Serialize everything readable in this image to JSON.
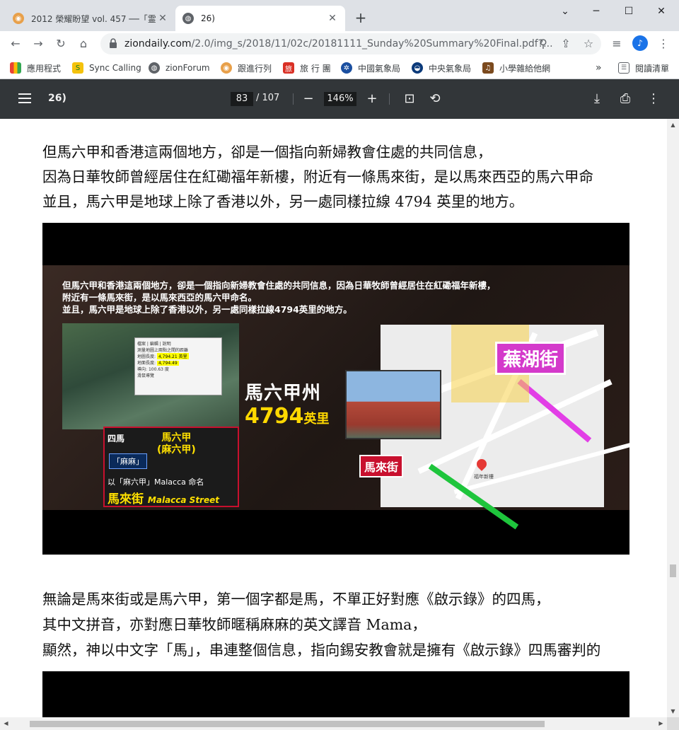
{
  "tabs": [
    {
      "title": "2012 榮耀盼望 vol. 457 ──「霊…",
      "active": false
    },
    {
      "title": "26)",
      "active": true
    }
  ],
  "window_controls": {
    "minimize": "─",
    "maximize": "☐",
    "close": "✕"
  },
  "address": {
    "domain": "ziondaily.com",
    "path": "/2.0/img_s/2018/11/02c/20181111_Sunday%20Summary%20Final.pdf?..."
  },
  "avatar_letter": "♪",
  "bookmarks": [
    {
      "label": "應用程式",
      "icon": "apps-grid-icon"
    },
    {
      "label": "Sync Calling",
      "icon": "sync-calling-icon"
    },
    {
      "label": "zionForum",
      "icon": "globe-icon"
    },
    {
      "label": "跟進行列",
      "icon": "follow-queue-icon"
    },
    {
      "label": "旅 行 團",
      "icon": "travel-icon"
    },
    {
      "label": "中國氣象局",
      "icon": "cma-icon"
    },
    {
      "label": "中央氣象局",
      "icon": "cwb-icon"
    },
    {
      "label": "小學雜給他網",
      "icon": "school-icon"
    }
  ],
  "bookmarks_more": "»",
  "reading_list": "閱讀清單",
  "pdf": {
    "doc_title": "26)",
    "current_page": "83",
    "total_pages": "/ 107",
    "zoom": "146%"
  },
  "paragraphs_top": [
    "但馬六甲和香港這兩個地方，卻是一個指向新婦教會住處的共同信息，",
    "因為日華牧師曾經居住在紅磡福年新樓，附近有一條馬來街，是以馬來西亞的馬六甲命",
    "並且，馬六甲是地球上除了香港以外，另一處同樣拉線 4794 英里的地方。"
  ],
  "slide": {
    "caption": [
      "但馬六甲和香港這兩個地方，卻是一個指向新婦教會住處的共同信息，因為日華牧師曾經居住在紅磡福年新樓，",
      "附近有一條馬來街，是以馬來西亞的馬六甲命名。",
      "並且，馬六甲是地球上除了香港以外，另一處同樣拉線4794英里的地方。"
    ],
    "dialog_lines": [
      "檔案 | 編輯 | 說明",
      "測量地圖上兩點之間的距離",
      "地圖長度:",
      "4,794.21 英里",
      "地面長度:",
      "4,794.49",
      "導向:",
      "100.63 度",
      "滑鼠導覽"
    ],
    "four_horses": "四馬",
    "malacca_zh": "馬六甲",
    "malacca_ma": "(麻六甲)",
    "mama": "「麻麻」",
    "named_after": "以「麻六甲」Malacca 命名",
    "malacca_street": "馬來街",
    "malacca_street_en": "Malacca Street",
    "malacca_state": "馬六甲州",
    "miles_value": "4794",
    "miles_unit": "英里",
    "wuhu_street": "蕪湖街",
    "malai_street": "馬來街",
    "pin_label": "福年新樓"
  },
  "paragraphs_bottom": [
    "無論是馬來街或是馬六甲，第一個字都是馬，不單正好對應《啟示錄》的四馬，",
    "其中文拼音，亦對應日華牧師暱稱麻麻的英文譯音 Mama，",
    "顯然，神以中文字「馬」，串連整個信息，指向錫安教會就是擁有《啟示錄》四馬審判的"
  ]
}
